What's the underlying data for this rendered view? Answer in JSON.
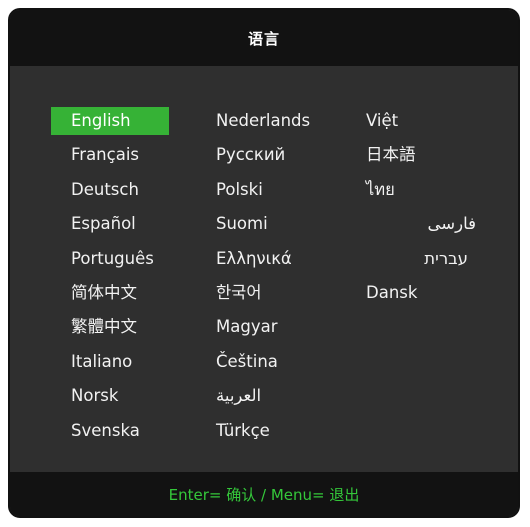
{
  "header": {
    "title": "语言"
  },
  "languages": {
    "col1": [
      "English",
      "Français",
      "Deutsch",
      "Español",
      "Português",
      "简体中文",
      "繁體中文",
      "Italiano",
      "Norsk",
      "Svenska"
    ],
    "col2": [
      "Nederlands",
      "Русский",
      "Polski",
      "Suomi",
      "Ελληνικά",
      "한국어",
      "Magyar",
      "Čeština",
      "العربية",
      "Türkçe"
    ],
    "col3": [
      "Việt",
      "日本語",
      "ไทย",
      "فارسی",
      "עברית",
      "Dansk"
    ],
    "selected": "English"
  },
  "footer": {
    "hint": "Enter= 确认 / Menu= 退出"
  },
  "colors": {
    "selection": "#36b236",
    "footer_text": "#34c73a",
    "background": "#2f2f2f",
    "bars": "#121212"
  }
}
